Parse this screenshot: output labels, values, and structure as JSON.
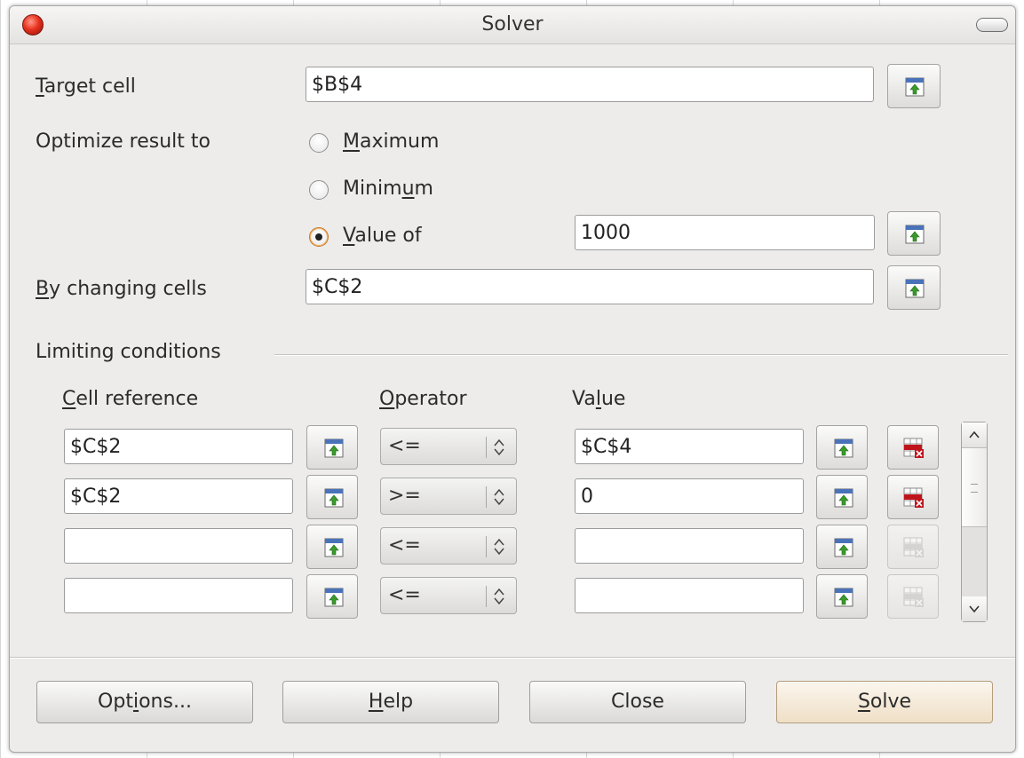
{
  "window": {
    "title": "Solver"
  },
  "target": {
    "label_pre": "",
    "label_u": "T",
    "label_post": "arget cell",
    "value": "$B$4"
  },
  "optimize": {
    "label": "Optimize result to",
    "options": [
      {
        "pre": "",
        "u": "M",
        "post": "aximum",
        "selected": false
      },
      {
        "pre": "Minim",
        "u": "u",
        "post": "m",
        "selected": false
      },
      {
        "pre": "",
        "u": "V",
        "post": "alue of",
        "selected": true
      }
    ],
    "value_of": "1000"
  },
  "changing": {
    "label_pre": "",
    "label_u": "B",
    "label_post": "y changing cells",
    "value": "$C$2"
  },
  "limits": {
    "group_label": "Limiting conditions",
    "headers": {
      "cell_pre": "",
      "cell_u": "C",
      "cell_post": "ell reference",
      "op_pre": "",
      "op_u": "O",
      "op_post": "perator",
      "val_pre": "Va",
      "val_u": "l",
      "val_post": "ue"
    },
    "rows": [
      {
        "cell": "$C$2",
        "operator": "<=",
        "value": "$C$4",
        "removable": true
      },
      {
        "cell": "$C$2",
        "operator": ">=",
        "value": "0",
        "removable": true
      },
      {
        "cell": "",
        "operator": "<=",
        "value": "",
        "removable": false
      },
      {
        "cell": "",
        "operator": "<=",
        "value": "",
        "removable": false
      }
    ]
  },
  "buttons": {
    "options_pre": "Opt",
    "options_u": "i",
    "options_post": "ons...",
    "help_pre": "",
    "help_u": "H",
    "help_post": "elp",
    "close": "Close",
    "solve_pre": "",
    "solve_u": "S",
    "solve_post": "olve"
  },
  "colors": {
    "dialog_bg": "#edeceb",
    "default_button": "#efdfc6",
    "remove_icon_red": "#c0141c",
    "shrink_icon_green": "#3a9a2c"
  }
}
